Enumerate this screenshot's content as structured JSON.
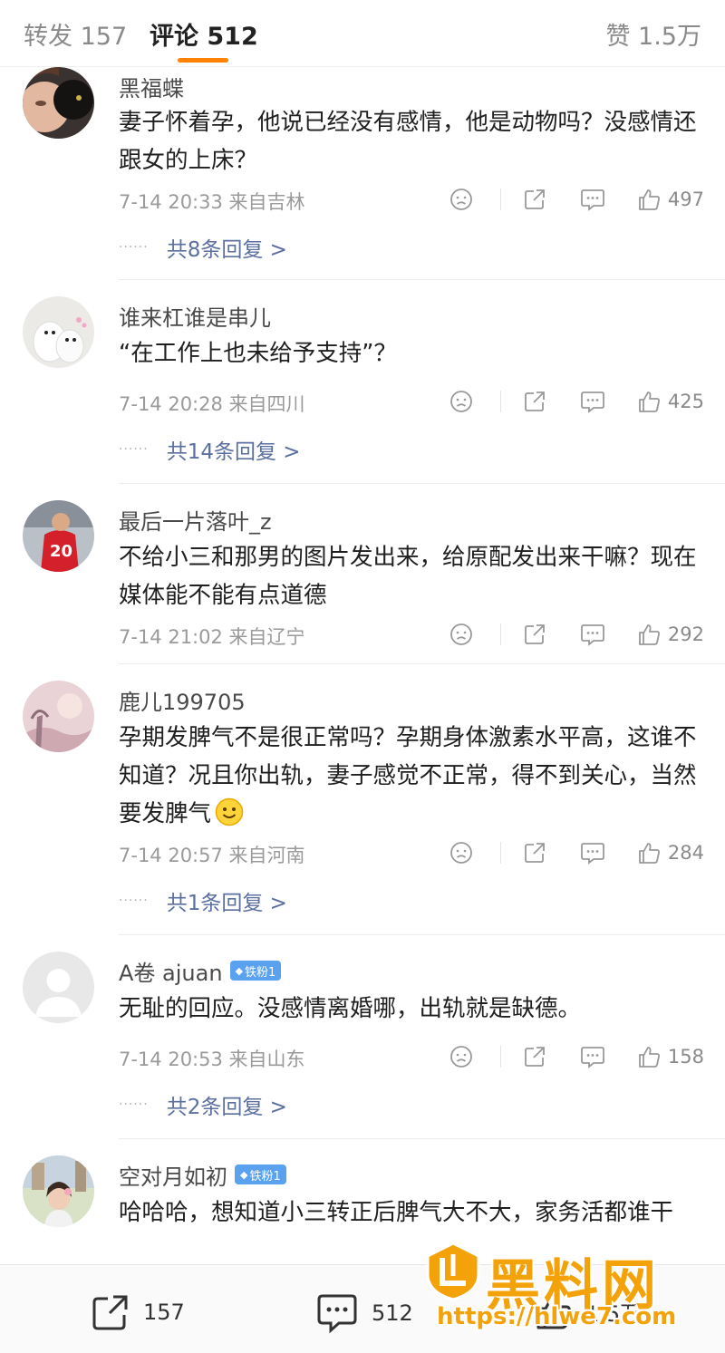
{
  "tabs": {
    "reposts": "转发 157",
    "comments": "评论 512",
    "likes": "赞 1.5万"
  },
  "comments": [
    {
      "username": "黑福蝶",
      "badge": "",
      "text": "妻子怀着孕，他说已经没有感情，他是动物吗？没感情还跟女的上床？",
      "meta": "7-14 20:33 来自吉林",
      "likes": "497",
      "replies": "共8条回复 >",
      "avatar": "woman-black-cat-avatar"
    },
    {
      "username": "谁来杠谁是串儿",
      "badge": "",
      "text": "“在工作上也未给予支持”？",
      "meta": "7-14 20:28 来自四川",
      "likes": "425",
      "replies": "共14条回复 >",
      "avatar": "white-dogs-avatar"
    },
    {
      "username": "最后一片落叶_z",
      "badge": "",
      "text": "不给小三和那男的图片发出来，给原配发出来干嘛？现在媒体能不能有点道德",
      "meta": "7-14 21:02 来自辽宁",
      "likes": "292",
      "replies": "",
      "avatar": "football-player-avatar"
    },
    {
      "username": "鹿儿199705",
      "badge": "",
      "text": "孕期发脾气不是很正常吗？孕期身体激素水平高，这谁不知道？况且你出轨，妻子感觉不正常，得不到关心，当然要发脾气",
      "emoji": "🙂",
      "meta": "7-14 20:57 来自河南",
      "likes": "284",
      "replies": "共1条回复 >",
      "avatar": "pink-scenery-avatar"
    },
    {
      "username": "A卷 ajuan",
      "badge": "铁粉1",
      "text": "无耻的回应。没感情离婚哪，出轨就是缺德。",
      "meta": "7-14 20:53 来自山东",
      "likes": "158",
      "replies": "共2条回复 >",
      "avatar": "default-avatar"
    },
    {
      "username": "空对月如初",
      "badge": "铁粉1",
      "text": "哈哈哈，想知道小三转正后脾气大不大，家务活都谁干",
      "meta": "",
      "likes": "",
      "replies": "",
      "avatar": "girl-street-avatar"
    }
  ],
  "bottom_bar": {
    "repost_count": "157",
    "comment_count": "512",
    "like_count": "1.5万"
  },
  "watermark": {
    "title": "黑料网",
    "url": "https://hlwe7.com"
  },
  "colors": {
    "accent": "#ff8200",
    "link": "#5b6fa0",
    "badge": "#5aa2f0",
    "watermark": "#f4a20a"
  }
}
